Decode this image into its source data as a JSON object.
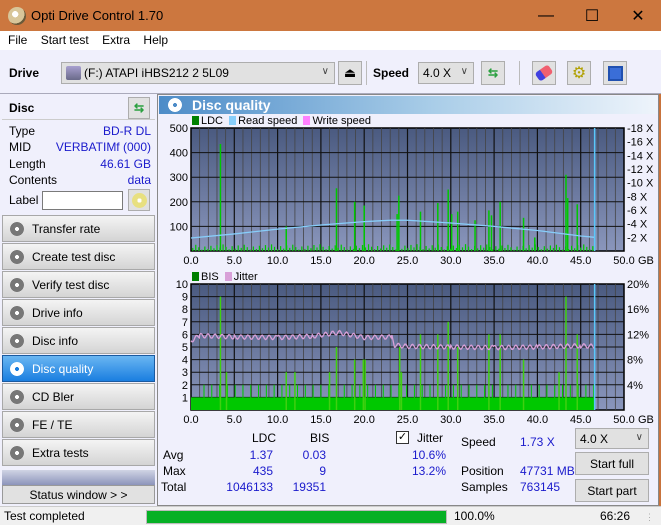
{
  "window": {
    "title": "Opti Drive Control 1.70",
    "controls": {
      "minimize": "—",
      "maximize": "☐",
      "close": "✕"
    }
  },
  "menu": [
    "File",
    "Start test",
    "Extra",
    "Help"
  ],
  "toolbar": {
    "drive_label": "Drive",
    "drive_value": "(F:)  ATAPI iHBS212   2 5L09",
    "speed_label": "Speed",
    "speed_value": "4.0 X",
    "icons": [
      "drive-icon",
      "eject-icon",
      "refresh-icon",
      "eraser-icon",
      "settings-icon",
      "save-icon"
    ]
  },
  "disc": {
    "header": "Disc",
    "rows": [
      {
        "key": "Type",
        "value": "BD-R DL"
      },
      {
        "key": "MID",
        "value": "VERBATIMf (000)"
      },
      {
        "key": "Length",
        "value": "46.61 GB"
      },
      {
        "key": "Contents",
        "value": "data"
      }
    ],
    "label_key": "Label",
    "label_value": ""
  },
  "nav": [
    {
      "label": "Transfer rate",
      "active": false
    },
    {
      "label": "Create test disc",
      "active": false
    },
    {
      "label": "Verify test disc",
      "active": false
    },
    {
      "label": "Drive info",
      "active": false
    },
    {
      "label": "Disc info",
      "active": false
    },
    {
      "label": "Disc quality",
      "active": true
    },
    {
      "label": "CD Bler",
      "active": false
    },
    {
      "label": "FE / TE",
      "active": false
    },
    {
      "label": "Extra tests",
      "active": false
    }
  ],
  "status_window_label": "Status window > >",
  "panel_title": "Disc quality",
  "chart_data": [
    {
      "type": "bar",
      "title": "LDC",
      "legend": [
        {
          "name": "LDC",
          "color": "#008000"
        },
        {
          "name": "Read speed",
          "color": "#87cefa"
        },
        {
          "name": "Write speed",
          "color": "#ff80ff"
        }
      ],
      "xlabel": "GB",
      "x_ticks": [
        "0.0",
        "5.0",
        "10.0",
        "15.0",
        "20.0",
        "25.0",
        "30.0",
        "35.0",
        "40.0",
        "45.0",
        "50.0"
      ],
      "xlim": [
        0,
        50
      ],
      "y_ticks": [
        "100",
        "200",
        "300",
        "400",
        "500"
      ],
      "ylim": [
        0,
        500
      ],
      "y2_ticks": [
        "2 X",
        "4 X",
        "6 X",
        "8 X",
        "10 X",
        "12 X",
        "14 X",
        "16 X",
        "18 X"
      ],
      "y2lim": [
        0,
        18
      ],
      "end_marker_gb": 46.61,
      "ldc_peaks": [
        {
          "x": 3.4,
          "y": 435
        },
        {
          "x": 11.0,
          "y": 100
        },
        {
          "x": 16.8,
          "y": 255
        },
        {
          "x": 18.9,
          "y": 200
        },
        {
          "x": 20.0,
          "y": 185
        },
        {
          "x": 24.0,
          "y": 225
        },
        {
          "x": 23.8,
          "y": 150
        },
        {
          "x": 26.5,
          "y": 160
        },
        {
          "x": 28.5,
          "y": 195
        },
        {
          "x": 29.7,
          "y": 250
        },
        {
          "x": 30.1,
          "y": 150
        },
        {
          "x": 30.8,
          "y": 160
        },
        {
          "x": 32.8,
          "y": 125
        },
        {
          "x": 34.4,
          "y": 165
        },
        {
          "x": 34.7,
          "y": 145
        },
        {
          "x": 35.7,
          "y": 200
        },
        {
          "x": 38.4,
          "y": 135
        },
        {
          "x": 39.7,
          "y": 55
        },
        {
          "x": 43.3,
          "y": 310
        },
        {
          "x": 43.5,
          "y": 215
        },
        {
          "x": 44.6,
          "y": 190
        }
      ],
      "read_speed": [
        {
          "x": 0,
          "y": 1.9
        },
        {
          "x": 5,
          "y": 2.5
        },
        {
          "x": 10,
          "y": 3.2
        },
        {
          "x": 15,
          "y": 3.8
        },
        {
          "x": 20,
          "y": 4.3
        },
        {
          "x": 23,
          "y": 4.5
        },
        {
          "x": 25,
          "y": 4.5
        },
        {
          "x": 30,
          "y": 4.1
        },
        {
          "x": 35,
          "y": 3.6
        },
        {
          "x": 40,
          "y": 3.0
        },
        {
          "x": 45,
          "y": 2.2
        },
        {
          "x": 46.6,
          "y": 2.0
        }
      ]
    },
    {
      "type": "bar",
      "title": "BIS",
      "legend": [
        {
          "name": "BIS",
          "color": "#008000"
        },
        {
          "name": "Jitter",
          "color": "#d8a0d8"
        }
      ],
      "xlabel": "GB",
      "x_ticks": [
        "0.0",
        "5.0",
        "10.0",
        "15.0",
        "20.0",
        "25.0",
        "30.0",
        "35.0",
        "40.0",
        "45.0",
        "50.0"
      ],
      "xlim": [
        0,
        50
      ],
      "y_ticks": [
        "1",
        "2",
        "3",
        "4",
        "5",
        "6",
        "7",
        "8",
        "9",
        "10"
      ],
      "ylim": [
        0,
        10
      ],
      "y2_ticks": [
        "4%",
        "8%",
        "12%",
        "16%",
        "20%"
      ],
      "y2lim": [
        0,
        20
      ],
      "end_marker_gb": 46.61,
      "bis_baseline": 1,
      "bis_peaks": [
        {
          "x": 3.4,
          "y": 9
        },
        {
          "x": 4.1,
          "y": 3
        },
        {
          "x": 11.0,
          "y": 3
        },
        {
          "x": 12.0,
          "y": 3
        },
        {
          "x": 16.0,
          "y": 3
        },
        {
          "x": 16.8,
          "y": 5
        },
        {
          "x": 18.9,
          "y": 4
        },
        {
          "x": 19.9,
          "y": 4
        },
        {
          "x": 20.1,
          "y": 4
        },
        {
          "x": 24.1,
          "y": 5
        },
        {
          "x": 24.3,
          "y": 3
        },
        {
          "x": 26.5,
          "y": 6
        },
        {
          "x": 28.5,
          "y": 6
        },
        {
          "x": 29.7,
          "y": 7
        },
        {
          "x": 30.8,
          "y": 5
        },
        {
          "x": 34.4,
          "y": 6
        },
        {
          "x": 35.7,
          "y": 6
        },
        {
          "x": 38.4,
          "y": 4
        },
        {
          "x": 43.3,
          "y": 9
        },
        {
          "x": 44.6,
          "y": 6
        },
        {
          "x": 42.5,
          "y": 3
        }
      ],
      "jitter": [
        {
          "x": 0,
          "y": 11.0
        },
        {
          "x": 1,
          "y": 11.8
        },
        {
          "x": 5,
          "y": 11.6
        },
        {
          "x": 10,
          "y": 11.5
        },
        {
          "x": 14,
          "y": 11.7
        },
        {
          "x": 17,
          "y": 12.3
        },
        {
          "x": 20,
          "y": 11.5
        },
        {
          "x": 23.2,
          "y": 11.6
        },
        {
          "x": 23.5,
          "y": 10.3
        },
        {
          "x": 25,
          "y": 10.1
        },
        {
          "x": 30,
          "y": 10.0
        },
        {
          "x": 35,
          "y": 9.9
        },
        {
          "x": 40,
          "y": 10.0
        },
        {
          "x": 45,
          "y": 10.2
        },
        {
          "x": 46.6,
          "y": 10.1
        }
      ]
    }
  ],
  "stats": {
    "headers": [
      "LDC",
      "BIS"
    ],
    "rows": [
      {
        "label": "Avg",
        "ldc": "1.37",
        "bis": "0.03",
        "jitter": "10.6%"
      },
      {
        "label": "Max",
        "ldc": "435",
        "bis": "9",
        "jitter": "13.2%"
      },
      {
        "label": "Total",
        "ldc": "1046133",
        "bis": "19351"
      }
    ],
    "jitter_label": "Jitter",
    "jitter_checked": true,
    "speed_label": "Speed",
    "speed_value": "1.73 X",
    "position_label": "Position",
    "position_value": "47731 MB",
    "samples_label": "Samples",
    "samples_value": "763145",
    "speed_select": "4.0 X",
    "start_full": "Start full",
    "start_part": "Start part"
  },
  "statusbar": {
    "text": "Test completed",
    "progress_percent": 100,
    "progress_label": "100.0%",
    "time": "66:26"
  }
}
